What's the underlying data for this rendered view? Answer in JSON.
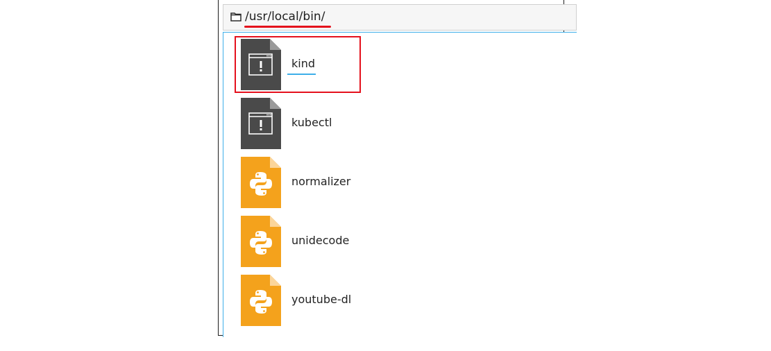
{
  "colors": {
    "accent": "#3daee9",
    "annotation": "#e4101c",
    "binary_icon": "#4a4a4a",
    "python_icon": "#f4a21c"
  },
  "location": {
    "icon": "folder-icon",
    "path": "/usr/local/bin/"
  },
  "files": [
    {
      "name": "kind",
      "type": "executable",
      "icon": "binary-executable-icon",
      "selected": true
    },
    {
      "name": "kubectl",
      "type": "executable",
      "icon": "binary-executable-icon"
    },
    {
      "name": "normalizer",
      "type": "python-script",
      "icon": "python-script-icon"
    },
    {
      "name": "unidecode",
      "type": "python-script",
      "icon": "python-script-icon"
    },
    {
      "name": "youtube-dl",
      "type": "python-script",
      "icon": "python-script-icon"
    }
  ]
}
